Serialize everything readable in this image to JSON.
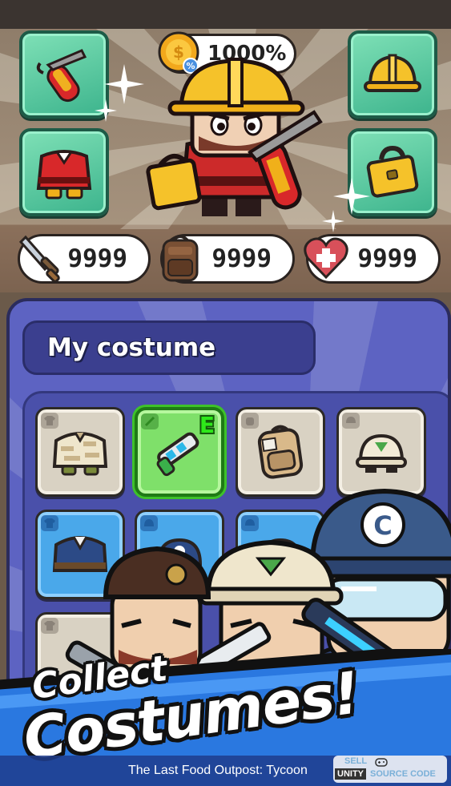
{
  "top_bar": {
    "boost_text": "1000%",
    "equipment_slots": [
      {
        "name": "extinguisher-slot",
        "icon": "fire-extinguisher-icon"
      },
      {
        "name": "helmet-slot",
        "icon": "hard-hat-icon"
      },
      {
        "name": "outfit-slot",
        "icon": "firefighter-suit-icon"
      },
      {
        "name": "toolbox-slot",
        "icon": "toolbox-icon"
      }
    ]
  },
  "stats": [
    {
      "icon": "sword-icon",
      "value": "9999"
    },
    {
      "icon": "backpack-icon",
      "value": "9999"
    },
    {
      "icon": "heart-icon",
      "value": "9999"
    }
  ],
  "costume_panel": {
    "title": "My costume",
    "equipped_badge": "E",
    "items": [
      {
        "icon": "camo-shirt-icon",
        "style": "cream"
      },
      {
        "icon": "water-gun-icon",
        "style": "green",
        "equipped": true
      },
      {
        "icon": "backpack-icon",
        "style": "cream"
      },
      {
        "icon": "cap-icon",
        "style": "cream"
      },
      {
        "icon": "blue-jacket-icon",
        "style": "blue"
      },
      {
        "icon": "police-cap-icon",
        "style": "blue"
      },
      {
        "icon": "blue-helmet-icon",
        "style": "blue"
      },
      {
        "icon": "blue-item-icon",
        "style": "blue"
      }
    ]
  },
  "promo": {
    "line1": "Collect",
    "line2": "Costumes!"
  },
  "footer": {
    "game_title": "The Last Food Outpost: Tycoon",
    "watermark_sell": "SELL",
    "watermark_unity": "UNITY",
    "watermark_source": "SOURCE CODE"
  },
  "colors": {
    "equip_slot": "#5fcfa3",
    "panel": "#5d63c2",
    "equipped_cell": "#7fe06a",
    "rare_cell": "#4aa8ea",
    "common_cell": "#d9d2c3"
  }
}
